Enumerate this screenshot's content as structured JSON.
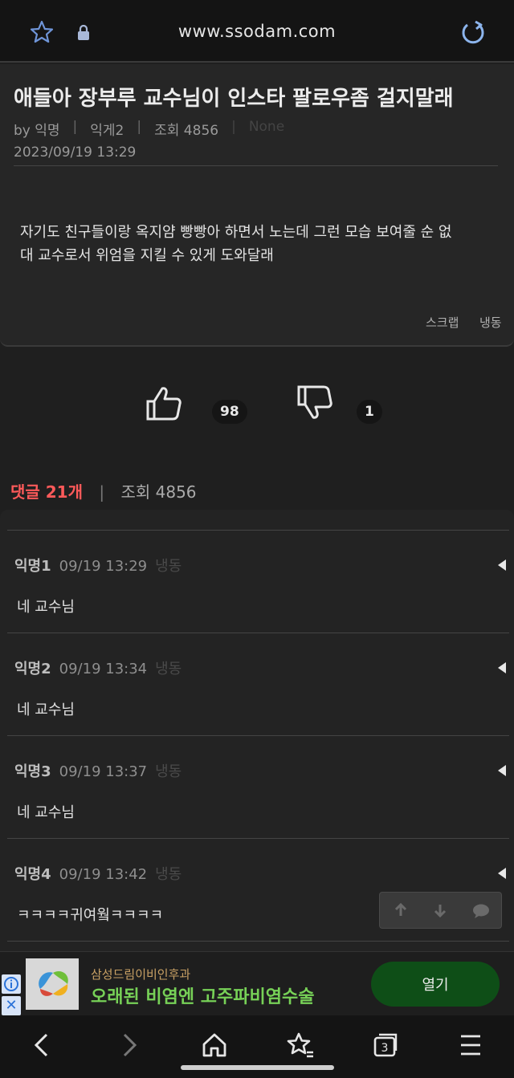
{
  "browser": {
    "url": "www.ssodam.com",
    "icons": {
      "bookmark": "star-icon",
      "secure": "lock-icon",
      "reload": "reload-icon"
    }
  },
  "post": {
    "title": "애들아 장부루 교수님이 인스타 팔로우좀 걸지말래",
    "meta": {
      "author": "by 익명",
      "board": "익게2",
      "views": "조회 4856",
      "extra": "None"
    },
    "date": "2023/09/19 13:29",
    "body_lines": [
      "자기도 친구들이랑 옥지얌 빵빵아 하면서 노는데 그런 모습 보여줄 순 없",
      "대 교수로서 위엄을 지킬 수 있게 도와달래"
    ],
    "actions": {
      "scrap": "스크랩",
      "freeze": "냉동"
    }
  },
  "votes": {
    "like_count": "98",
    "dislike_count": "1"
  },
  "comments_header": {
    "count_label": "댓글 21개",
    "views_label": "조회 4856"
  },
  "comments": [
    {
      "nick": "익명1",
      "time": "09/19 13:29",
      "freeze": "냉동",
      "text": "네 교수님"
    },
    {
      "nick": "익명2",
      "time": "09/19 13:34",
      "freeze": "냉동",
      "text": "네 교수님"
    },
    {
      "nick": "익명3",
      "time": "09/19 13:37",
      "freeze": "냉동",
      "text": "네 교수님"
    },
    {
      "nick": "익명4",
      "time": "09/19 13:42",
      "freeze": "냉동",
      "text": "ㅋㅋㅋㅋ귀여웤ㅋㅋㅋㅋ"
    }
  ],
  "ad": {
    "sponsor": "삼성드림이비인후과",
    "headline": "오래된 비염엔 고주파비염수술",
    "open_label": "열기",
    "close_label": "✕"
  },
  "bottom_nav": {
    "tab_count": "3"
  },
  "colors": {
    "accent_red": "#ff5a5a",
    "ad_green": "#77d157",
    "ad_button": "#0e4e17",
    "background": "#1f1f1f"
  }
}
